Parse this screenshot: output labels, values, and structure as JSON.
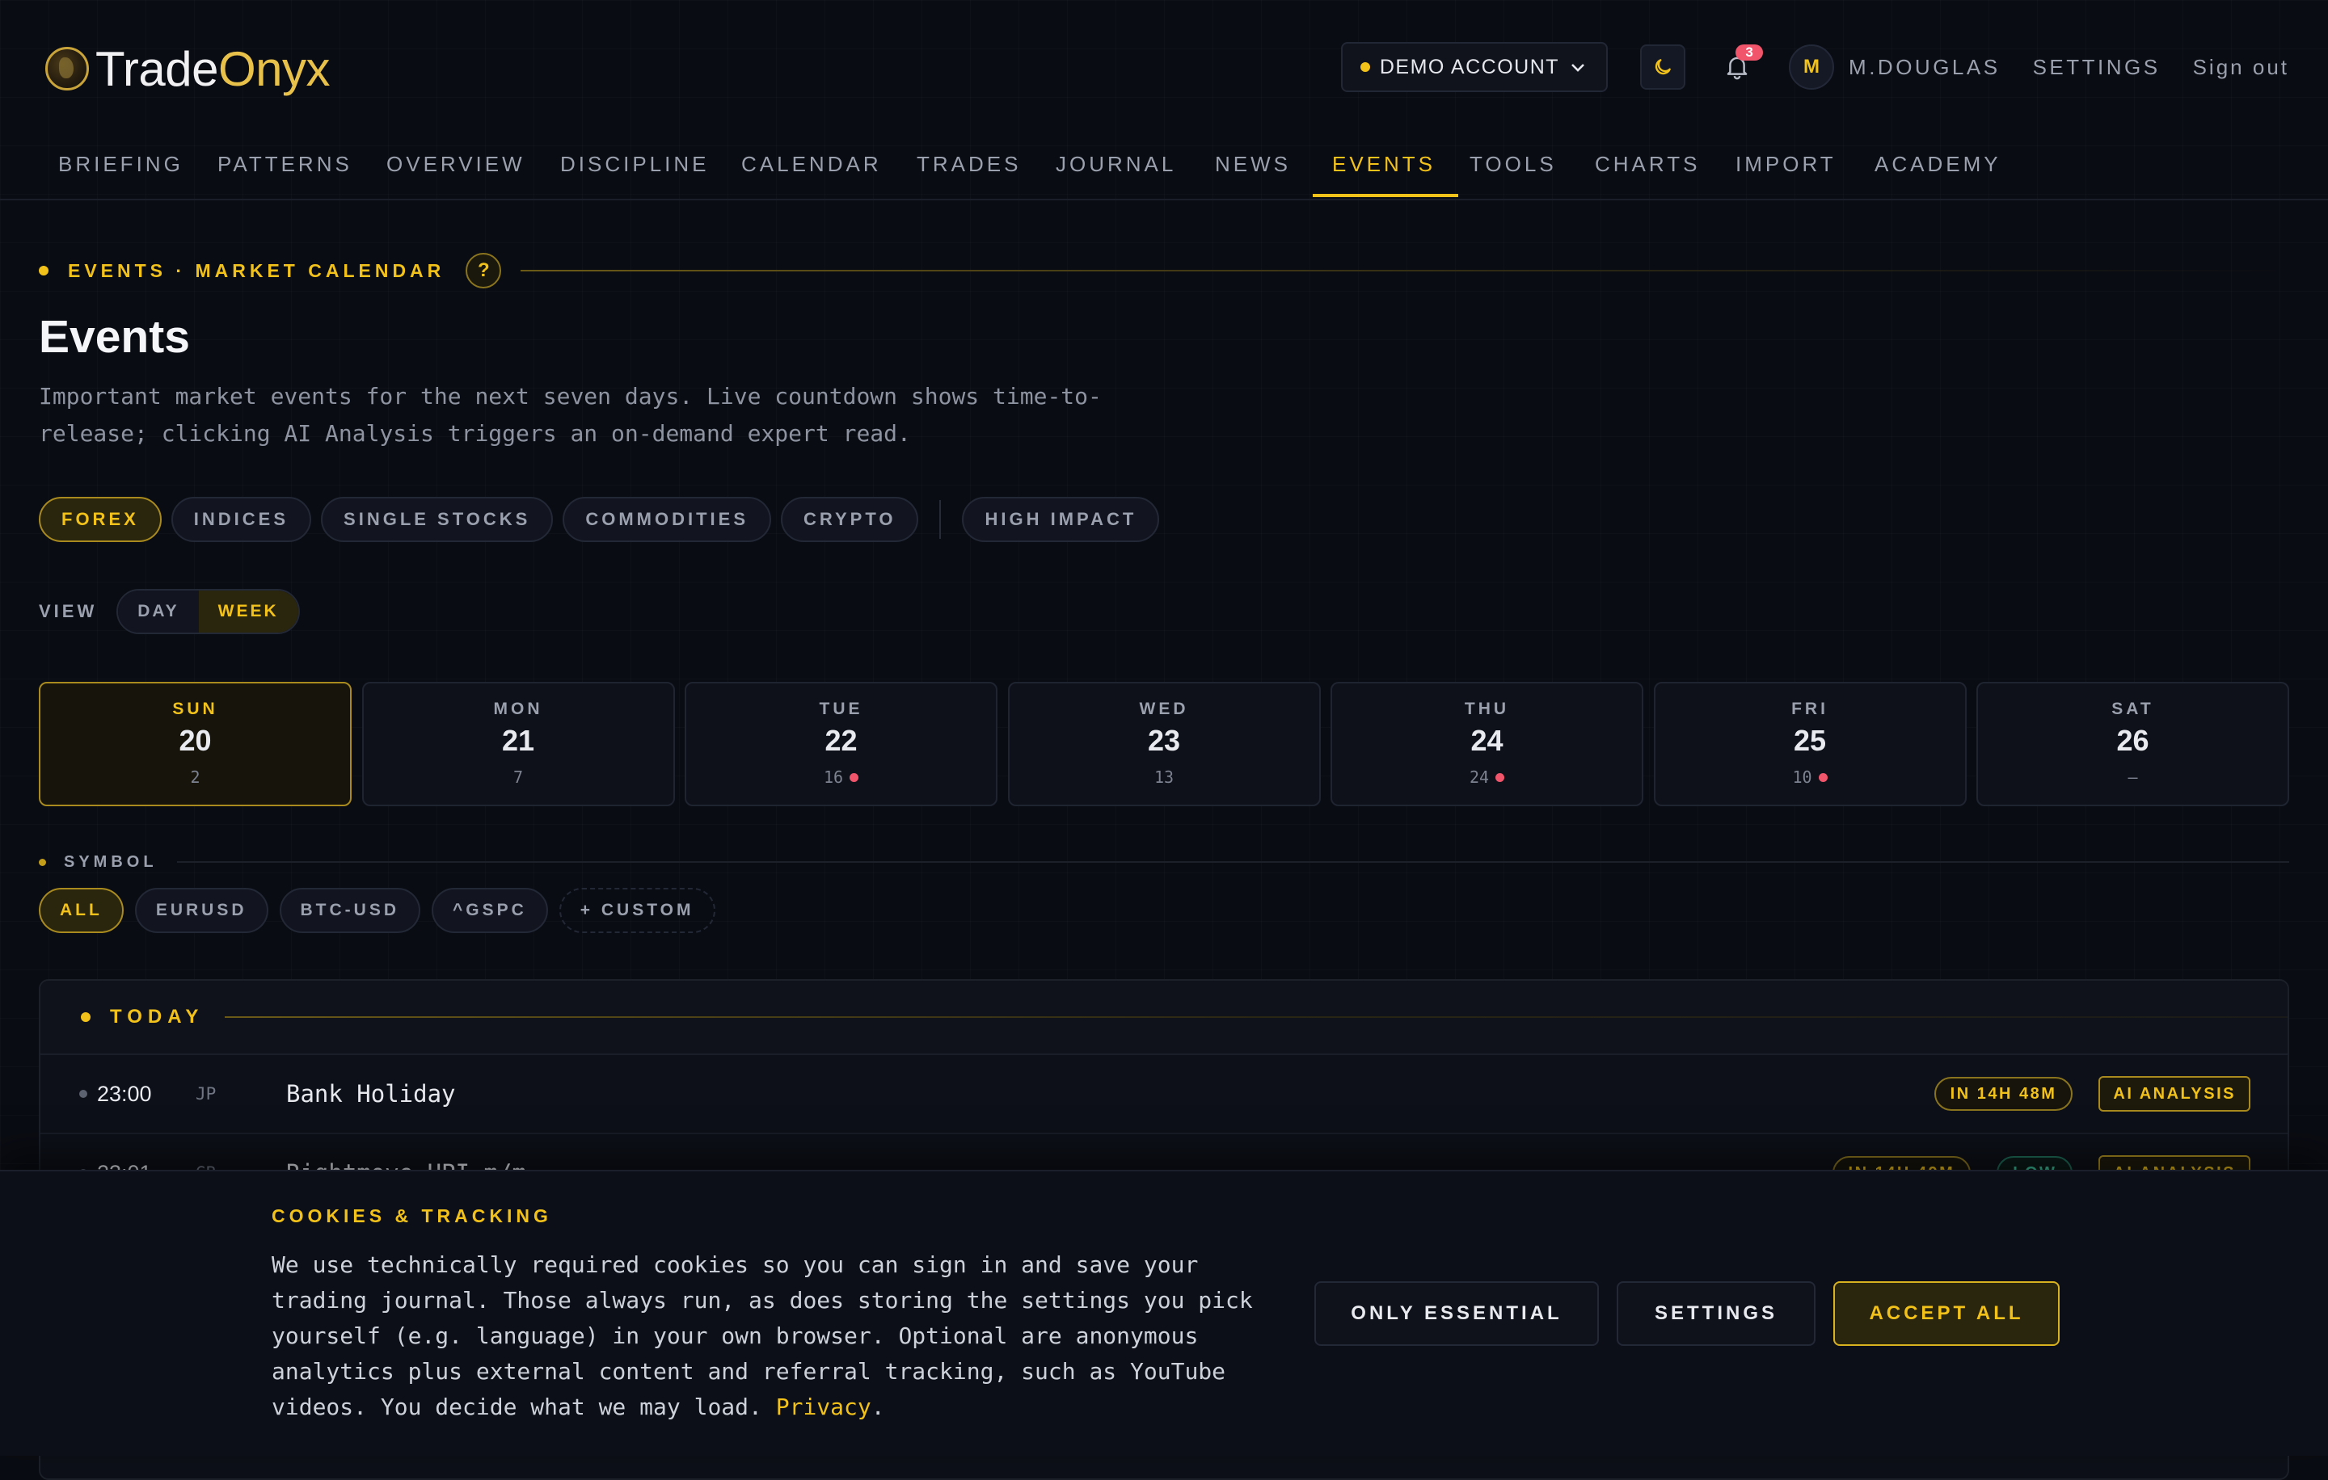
{
  "brand": {
    "part1": "Trade",
    "part2": "Onyx"
  },
  "header": {
    "account_label": "DEMO ACCOUNT",
    "notifications_count": "3",
    "avatar_initial": "M",
    "user_name": "M.DOUGLAS",
    "settings_label": "SETTINGS",
    "signout_label": "Sign out"
  },
  "nav": {
    "tabs": [
      "BRIEFING",
      "PATTERNS",
      "OVERVIEW",
      "DISCIPLINE",
      "CALENDAR",
      "TRADES",
      "JOURNAL",
      "NEWS",
      "EVENTS",
      "TOOLS",
      "CHARTS",
      "IMPORT",
      "ACADEMY"
    ],
    "active": "EVENTS"
  },
  "page": {
    "eyebrow": "EVENTS · MARKET CALENDAR",
    "help": "?",
    "title": "Events",
    "description": "Important market events for the next seven days. Live countdown shows time-to-release; clicking AI Analysis triggers an on-demand expert read."
  },
  "filters": {
    "markets": [
      "FOREX",
      "INDICES",
      "SINGLE STOCKS",
      "COMMODITIES",
      "CRYPTO"
    ],
    "active": "FOREX",
    "high_impact": "HIGH IMPACT"
  },
  "view": {
    "label": "VIEW",
    "day": "DAY",
    "week": "WEEK",
    "active": "WEEK"
  },
  "days": [
    {
      "name": "SUN",
      "num": "20",
      "count": "2",
      "high": false,
      "active": true
    },
    {
      "name": "MON",
      "num": "21",
      "count": "7",
      "high": false,
      "active": false
    },
    {
      "name": "TUE",
      "num": "22",
      "count": "16",
      "high": true,
      "active": false
    },
    {
      "name": "WED",
      "num": "23",
      "count": "13",
      "high": false,
      "active": false
    },
    {
      "name": "THU",
      "num": "24",
      "count": "24",
      "high": true,
      "active": false
    },
    {
      "name": "FRI",
      "num": "25",
      "count": "10",
      "high": true,
      "active": false
    },
    {
      "name": "SAT",
      "num": "26",
      "count": "—",
      "high": false,
      "active": false
    }
  ],
  "symbols": {
    "label": "SYMBOL",
    "all": "ALL",
    "items": [
      "EURUSD",
      "BTC-USD",
      "^GSPC"
    ],
    "custom": "+ CUSTOM"
  },
  "events": {
    "group_label": "TODAY",
    "ai_label": "AI ANALYSIS",
    "rows": [
      {
        "time": "23:00",
        "country": "JP",
        "title": "Bank Holiday",
        "countdown": "IN 14H 48M",
        "impact": ""
      },
      {
        "time": "23:01",
        "country": "GB",
        "title": "Rightmove HPI m/m",
        "countdown": "IN 14H 49M",
        "impact": "LOW"
      }
    ]
  },
  "cookie": {
    "title": "COOKIES & TRACKING",
    "text": "We use technically required cookies so you can sign in and save your trading journal. Those always run, as does storing the settings you pick yourself (e.g. language) in your own browser. Optional are anonymous analytics plus external content and referral tracking, such as YouTube videos. You decide what we may load. ",
    "privacy_link": "Privacy",
    "end": ".",
    "only_essential": "ONLY ESSENTIAL",
    "settings": "SETTINGS",
    "accept_all": "ACCEPT ALL"
  }
}
